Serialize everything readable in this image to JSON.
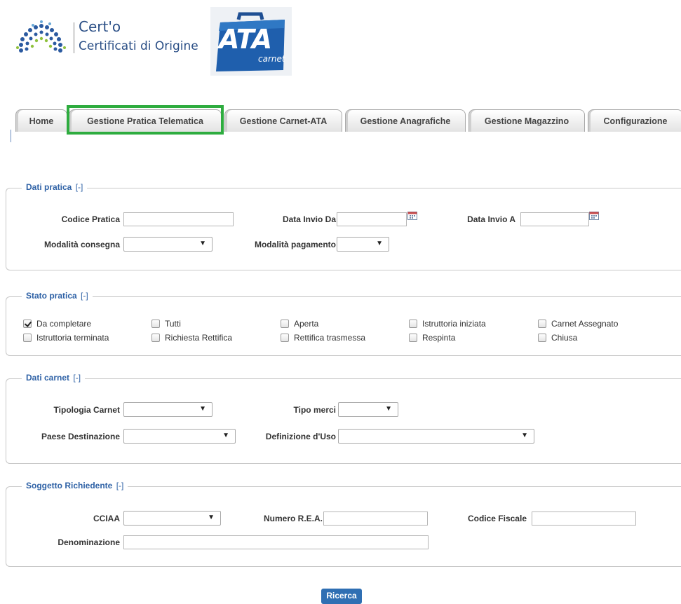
{
  "header": {
    "certo_title": "Cert'o",
    "certo_subtitle": "Certificati di Origine",
    "ata_logo_text": "ATA",
    "ata_logo_sub": "carnet"
  },
  "tabs": [
    {
      "label": "Home"
    },
    {
      "label": "Gestione Pratica Telematica",
      "active": true
    },
    {
      "label": "Gestione Carnet-ATA"
    },
    {
      "label": "Gestione Anagrafiche"
    },
    {
      "label": "Gestione Magazzino"
    },
    {
      "label": "Configurazione"
    }
  ],
  "dati_pratica": {
    "legend": "Dati pratica",
    "toggle": "[-]",
    "codice_pratica_label": "Codice Pratica",
    "codice_pratica_value": "",
    "data_invio_da_label": "Data Invio Da",
    "data_invio_da_value": "",
    "data_invio_a_label": "Data Invio A",
    "data_invio_a_value": "",
    "modalita_consegna_label": "Modalità consegna",
    "modalita_consegna_value": "",
    "modalita_pagamento_label": "Modalità pagamento",
    "modalita_pagamento_value": ""
  },
  "stato_pratica": {
    "legend": "Stato pratica",
    "toggle": "[-]",
    "options": [
      {
        "label": "Da completare",
        "checked": true
      },
      {
        "label": "Tutti",
        "checked": false
      },
      {
        "label": "Aperta",
        "checked": false
      },
      {
        "label": "Istruttoria iniziata",
        "checked": false
      },
      {
        "label": "Carnet Assegnato",
        "checked": false
      },
      {
        "label": "Istruttoria terminata",
        "checked": false
      },
      {
        "label": "Richiesta Rettifica",
        "checked": false
      },
      {
        "label": "Rettifica trasmessa",
        "checked": false
      },
      {
        "label": "Respinta",
        "checked": false
      },
      {
        "label": "Chiusa",
        "checked": false
      }
    ]
  },
  "dati_carnet": {
    "legend": "Dati carnet",
    "toggle": "[-]",
    "tipologia_label": "Tipologia Carnet",
    "tipologia_value": "",
    "tipo_merci_label": "Tipo merci",
    "tipo_merci_value": "",
    "paese_label": "Paese Destinazione",
    "paese_value": "",
    "definizione_label": "Definizione d'Uso",
    "definizione_value": ""
  },
  "soggetto": {
    "legend": "Soggetto Richiedente",
    "toggle": "[-]",
    "cciaa_label": "CCIAA",
    "cciaa_value": "",
    "rea_label": "Numero R.E.A.",
    "rea_value": "",
    "cf_label": "Codice Fiscale",
    "cf_value": "",
    "denominazione_label": "Denominazione",
    "denominazione_value": ""
  },
  "actions": {
    "search_label": "Ricerca"
  },
  "colors": {
    "legend_blue": "#2f62a6",
    "button_blue": "#2f6fb3",
    "highlight_green": "#2eac3f"
  }
}
